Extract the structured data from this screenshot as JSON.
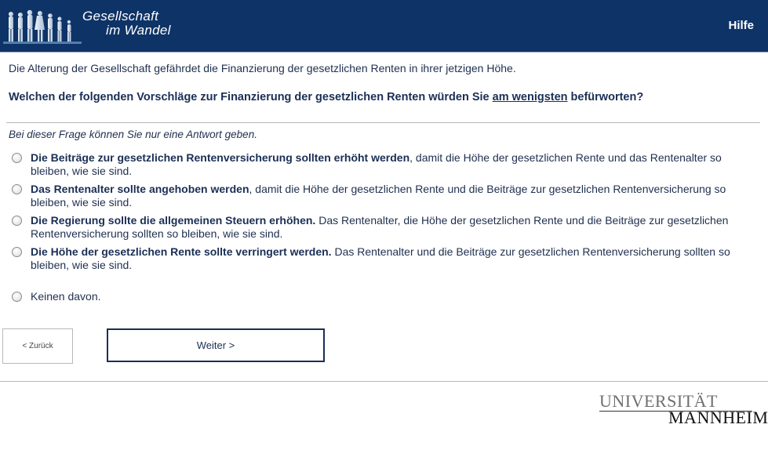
{
  "header": {
    "logo_line1": "Gesellschaft",
    "logo_line2": "im Wandel",
    "help_label": "Hilfe",
    "background_color": "#0e3366"
  },
  "main": {
    "intro": "Die Alterung der Gesellschaft gefährdet die Finanzierung der gesetzlichen Renten in ihrer jetzigen Höhe.",
    "question_before": "Welchen der folgenden Vorschläge zur Finanzierung der gesetzlichen Renten würden Sie ",
    "question_emphasis": "am wenigsten",
    "question_after": " befürworten?",
    "hint": "Bei dieser Frage können Sie nur eine Antwort geben.",
    "options": [
      {
        "bold": "Die Beiträge zur gesetzlichen Rentenversicherung sollten erhöht werden",
        "text": ", damit die Höhe der gesetzlichen Rente und das Rentenalter so bleiben, wie sie sind."
      },
      {
        "bold": "Das Rentenalter sollte angehoben werden",
        "text": ", damit die Höhe der gesetzlichen Rente und die Beiträge zur gesetzlichen Rentenversicherung so bleiben, wie sie sind."
      },
      {
        "bold": "Die Regierung sollte die allgemeinen Steuern erhöhen.",
        "text": " Das Rentenalter, die Höhe der gesetzlichen Rente und die Beiträge zur gesetzlichen Rentenversicherung sollten so bleiben, wie sie sind."
      },
      {
        "bold": "Die Höhe der gesetzlichen Rente sollte verringert werden.",
        "text": " Das Rentenalter und die Beiträge zur gesetzlichen Rentenversicherung sollten so bleiben, wie sie sind."
      },
      {
        "bold": "",
        "text": "Keinen davon."
      }
    ]
  },
  "nav": {
    "back_label": "< Zurück",
    "next_label": "Weiter >"
  },
  "footer": {
    "uni_line1": "UNIVERSITÄT",
    "uni_line2": "MANNHEIM"
  }
}
